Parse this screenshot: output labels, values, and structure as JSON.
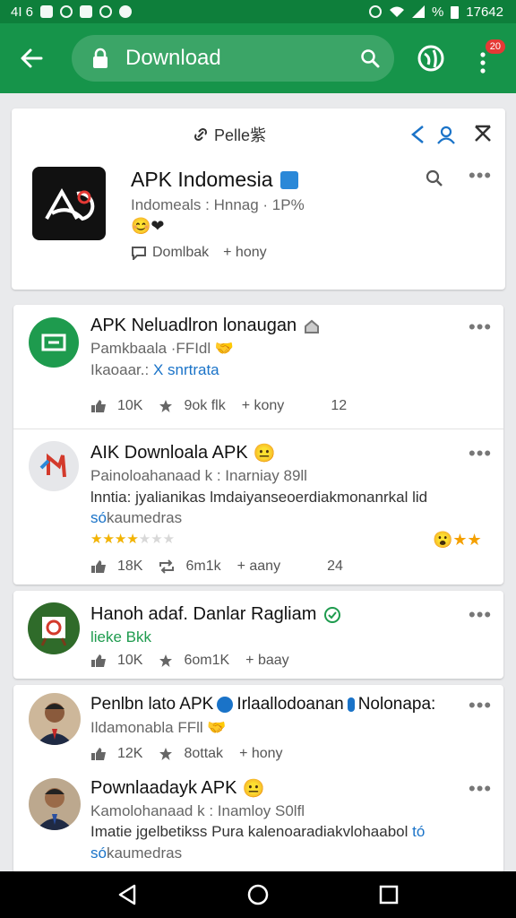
{
  "status_bar": {
    "left_text": "4I 6",
    "right_text": "%",
    "time": "17642"
  },
  "app_bar": {
    "search_query": "Download",
    "menu_badge": "20"
  },
  "featured": {
    "header_label": "Pelle紫",
    "title": "APK Indomesia",
    "subtitle": "Indomeals : Hnnag · 1P%",
    "emoji": "😊❤",
    "download_label": "Domlbak",
    "plus_label": "+ hony"
  },
  "list": [
    {
      "title": "APK Neluadlron lonaugan",
      "line1": "Pamkbaala ·FFIdl",
      "line1_emoji": "🤝",
      "line2_prefix": "Ikaoaar.: ",
      "line2_link": "X snrtrata",
      "stats": [
        "10K",
        "9ok flk",
        "+ kony"
      ],
      "extra": "12"
    },
    {
      "title": "AIK Downloala APK",
      "title_emoji": "😐",
      "line1": "Painoloahanaad k : Inarniay 89ll",
      "line2": "lnntia: jyalianikas lmdaiyanseoerdiakmonanrkal lid",
      "line3_link": "só",
      "line3_rest": "kaumedras",
      "rating_stars": "★★★★★★★",
      "rating_value": 0.57,
      "reactions": "😮★★",
      "stats": [
        "18K",
        "6m1k",
        "+ aany"
      ],
      "extra": "24"
    },
    {
      "title": "Hanoh adaf. Danlar Ragliam",
      "line1": "lieke Bkk",
      "stats": [
        "10K",
        "6om1K",
        "+ baay"
      ]
    },
    {
      "title_prefix": "Penlbn lato APK ",
      "title_suffix": " Irlaallodoanan ",
      "title_tail": " Nolonapa:",
      "line1": "Ildamonabla FFll",
      "line1_emoji": "🤝",
      "stats": [
        "12K",
        "8ottak",
        "+ hony"
      ]
    },
    {
      "title": "Pownlaadayk APK",
      "title_emoji": "😐",
      "line1": "Kamolohanaad k : Inamloy S0lfl",
      "line2": "Imatie jgelbetikss Pura kalenoaradiakvlohaabol",
      "line2_link": "tó",
      "line3_link": "só",
      "line3_rest": "kaumedras"
    }
  ],
  "colors": {
    "status_bar": "#0e7f3b",
    "app_bar": "#16944a",
    "background": "#e9eaec",
    "link_blue": "#1a73c8",
    "star": "#f4b400"
  }
}
